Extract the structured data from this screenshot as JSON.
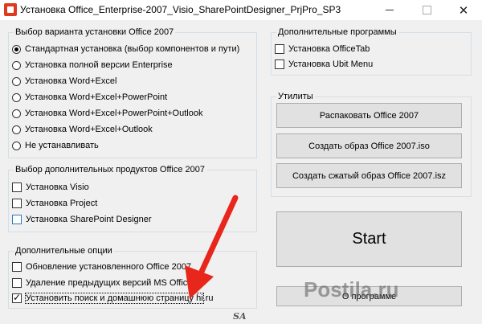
{
  "window": {
    "title": "Установка Office_Enterprise-2007_Visio_SharePointDesigner_PrjPro_SP3",
    "minimize": "—",
    "close": "✕"
  },
  "install_variant": {
    "title": "Выбор варианта установки Office 2007",
    "options": [
      {
        "label": "Стандартная установка (выбор компонентов и пути)",
        "selected": true
      },
      {
        "label": "Установка полной версии Enterprise",
        "selected": false
      },
      {
        "label": "Установка Word+Excel",
        "selected": false
      },
      {
        "label": "Установка Word+Excel+PowerPoint",
        "selected": false
      },
      {
        "label": "Установка Word+Excel+PowerPoint+Outlook",
        "selected": false
      },
      {
        "label": "Установка Word+Excel+Outlook",
        "selected": false
      },
      {
        "label": "Не устанавливать",
        "selected": false
      }
    ]
  },
  "extra_products": {
    "title": "Выбор дополнительных продуктов Office 2007",
    "items": [
      {
        "label": "Установка Visio",
        "checked": false
      },
      {
        "label": "Установка Project",
        "checked": false
      },
      {
        "label": "Установка SharePoint Designer",
        "checked": false
      }
    ]
  },
  "extra_options": {
    "title": "Дополнительные опции",
    "items": [
      {
        "label": "Обновление установленного Office 2007",
        "checked": false
      },
      {
        "label": "Удаление предыдущих версий MS Office",
        "checked": false
      },
      {
        "label": "Установить поиск и домашнюю страницу hi.ru",
        "checked": true
      }
    ]
  },
  "extra_programs": {
    "title": "Дополнительные программы",
    "items": [
      {
        "label": "Установка OfficeTab",
        "checked": false
      },
      {
        "label": "Установка Ubit Menu",
        "checked": false
      }
    ]
  },
  "utilities": {
    "title": "Утилиты",
    "buttons": [
      "Распаковать Office 2007",
      "Создать образ Office 2007.iso",
      "Создать сжатый образ Office 2007.isz"
    ]
  },
  "start_label": "Start",
  "about_label": "О программе",
  "footer_logo": "SA",
  "watermark": "Postila.ru",
  "colors": {
    "arrow": "#e8261c",
    "focus_checkbox": "#2b78c5"
  }
}
